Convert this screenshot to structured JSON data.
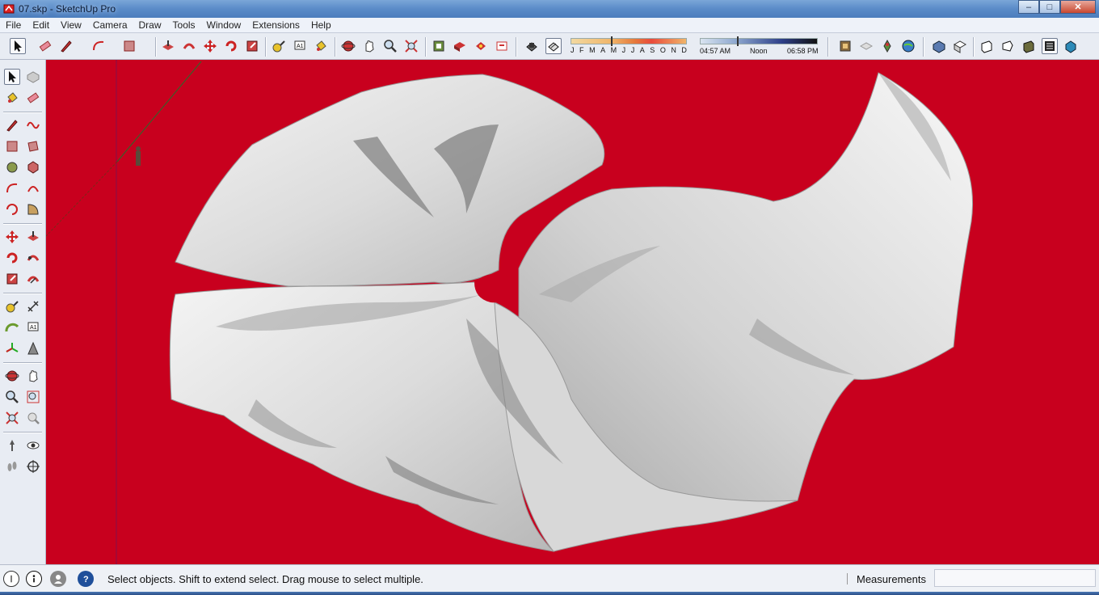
{
  "window": {
    "title": "07.skp - SketchUp Pro",
    "minimize_glyph": "–",
    "maximize_glyph": "□",
    "close_glyph": "✕"
  },
  "menu": {
    "items": [
      "File",
      "Edit",
      "View",
      "Camera",
      "Draw",
      "Tools",
      "Window",
      "Extensions",
      "Help"
    ]
  },
  "shadow_settings": {
    "months": [
      "J",
      "F",
      "M",
      "A",
      "M",
      "J",
      "J",
      "A",
      "S",
      "O",
      "N",
      "D"
    ],
    "time_start": "04:57 AM",
    "time_mid": "Noon",
    "time_end": "06:58 PM"
  },
  "status": {
    "message": "Select objects. Shift to extend select. Drag mouse to select multiple.",
    "measurements_label": "Measurements",
    "measurements_value": ""
  },
  "colors": {
    "viewport_background": "#c8001e",
    "title_bar": "#5a8bc8",
    "surface": "#e6e6e6"
  },
  "icons": {
    "toolbar": [
      "select-icon",
      "eraser-icon",
      "pencil-icon",
      "arc-icon",
      "rectangle-icon",
      "push-pull-icon",
      "follow-me-icon",
      "move-icon",
      "rotate-icon",
      "scale-icon",
      "tape-measure-icon",
      "text-icon",
      "paint-bucket-icon",
      "orbit-icon",
      "pan-icon",
      "zoom-icon",
      "zoom-extents-icon",
      "warehouse-icon",
      "components-icon",
      "share-model-icon",
      "extension-icon",
      "x-ray-icon",
      "back-edges-icon",
      "house-icon",
      "shaded-icon",
      "geo-location-icon",
      "globe-icon",
      "iso-view-icon",
      "top-view-icon",
      "front-view-icon",
      "right-view-icon",
      "back-view-icon",
      "left-view-icon"
    ]
  }
}
